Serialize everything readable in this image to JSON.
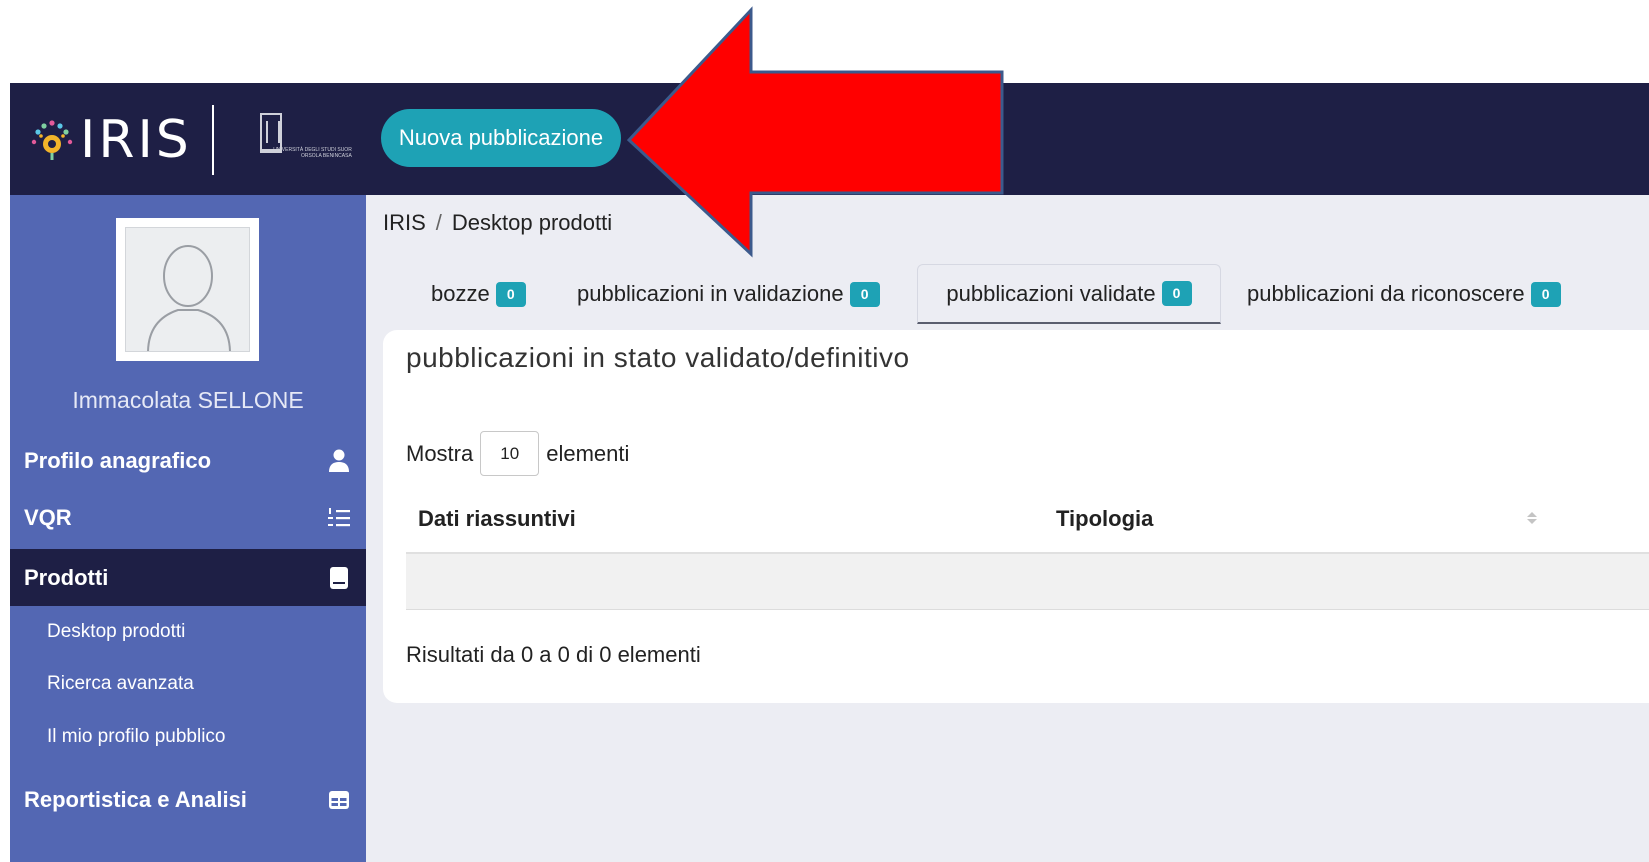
{
  "header": {
    "logo_text": "IRIS",
    "university_caption": "UNIVERSITÀ DEGLI STUDI SUOR ORSOLA BENINCASA",
    "new_publication_label": "Nuova pubblicazione"
  },
  "sidebar": {
    "user_name": "Immacolata  SELLONE",
    "items": [
      {
        "label": "Profilo anagrafico",
        "icon": "user-icon"
      },
      {
        "label": "VQR",
        "icon": "list-ordered-icon"
      },
      {
        "label": "Prodotti",
        "icon": "book-icon",
        "active": true
      },
      {
        "label": "Reportistica e Analisi",
        "icon": "table-icon"
      }
    ],
    "sub_items": [
      {
        "label": "Desktop prodotti"
      },
      {
        "label": "Ricerca avanzata"
      },
      {
        "label": "Il mio profilo pubblico"
      }
    ]
  },
  "breadcrumb": {
    "root": "IRIS",
    "separator": "/",
    "current": "Desktop prodotti"
  },
  "tabs": [
    {
      "label": "bozze",
      "count": "0"
    },
    {
      "label": "pubblicazioni in validazione",
      "count": "0"
    },
    {
      "label": "pubblicazioni validate",
      "count": "0",
      "active": true
    },
    {
      "label": "pubblicazioni da riconoscere",
      "count": "0"
    }
  ],
  "main": {
    "card_title": "pubblicazioni in stato validato/definitivo",
    "show_prefix": "Mostra",
    "show_value": "10",
    "show_suffix": "elementi",
    "columns": [
      "Dati riassuntivi",
      "Tipologia"
    ],
    "info_text": "Risultati da 0 a 0 di 0 elementi"
  },
  "colors": {
    "topbar": "#1e1f45",
    "sidebar": "#5367b3",
    "accent": "#1ea2b5",
    "annotation_arrow": "#ff0000",
    "annotation_arrow_border": "#3c5a8c"
  }
}
